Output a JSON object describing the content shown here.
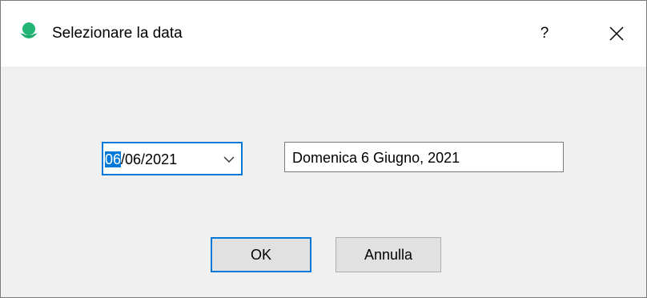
{
  "window": {
    "title": "Selezionare la data",
    "help_label": "?",
    "app_icon": "app-logo-icon",
    "close_icon": "close-icon"
  },
  "date_picker": {
    "selected_part": "06",
    "rest": "/06/2021",
    "dropdown_icon": "chevron-down-icon",
    "accent_color": "#0078d7"
  },
  "long_date": {
    "value": "Domenica  6 Giugno, 2021"
  },
  "buttons": {
    "ok_label": "OK",
    "cancel_label": "Annulla"
  }
}
